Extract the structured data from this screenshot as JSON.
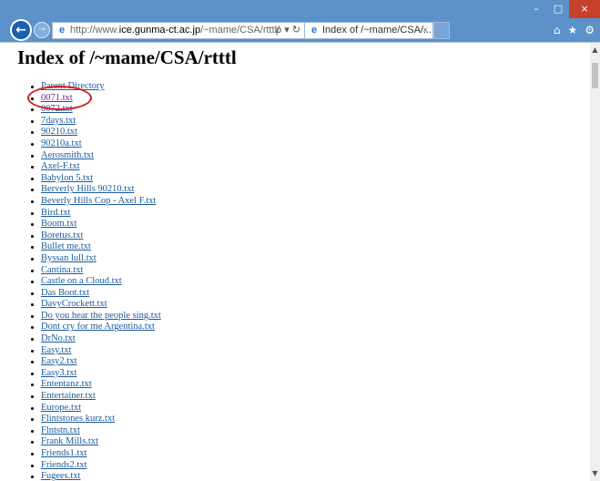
{
  "window": {
    "minimize": "–",
    "maximize": "□",
    "close": "×"
  },
  "browser": {
    "back_icon": "back-arrow-icon",
    "forward_icon": "forward-arrow-icon",
    "address_prefix": "http://www.",
    "address_host": "ice.gunma-ct.ac.jp",
    "address_path": "/~mame/CSA/rtttl/",
    "address_controls": "ρ ▾ ↻",
    "tab_title": "Index of /~mame/CSA/...",
    "tab_close": "×",
    "tools": [
      "⌂",
      "★",
      "⚙"
    ]
  },
  "page": {
    "title": "Index of /~mame/CSA/rtttl",
    "items": [
      "Parent Directory",
      "0071.txt",
      "0072.txt",
      "7days.txt",
      "90210.txt",
      "90210a.txt",
      "Aerosmith.txt",
      "Axel-F.txt",
      "Babylon 5.txt",
      "Berverly Hills 90210.txt",
      "Beverly Hills Cop - Axel F.txt",
      "Bird.txt",
      "Boom.txt",
      "Boretus.txt",
      "Bullet me.txt",
      "Byssan lull.txt",
      "Cantina.txt",
      "Castle on a Cloud.txt",
      "Das Boot.txt",
      "DavyCrockett.txt",
      "Do you hear the people sing.txt",
      "Dont cry for me Argentina.txt",
      "DrNo.txt",
      "Easy.txt",
      "Easy2.txt",
      "Easy3.txt",
      "Ententanz.txt",
      "Entertainer.txt",
      "Europe.txt",
      "Flintstones kurz.txt",
      "Flntstn.txt",
      "Frank Mills.txt",
      "Friends1.txt",
      "Friends2.txt",
      "Fugees.txt"
    ],
    "visited_index": 1
  },
  "colors": {
    "link": "#1a5a9a",
    "visited": "#6b2b8c",
    "highlight_circle": "#d02020",
    "chrome": "#5c92c9"
  }
}
